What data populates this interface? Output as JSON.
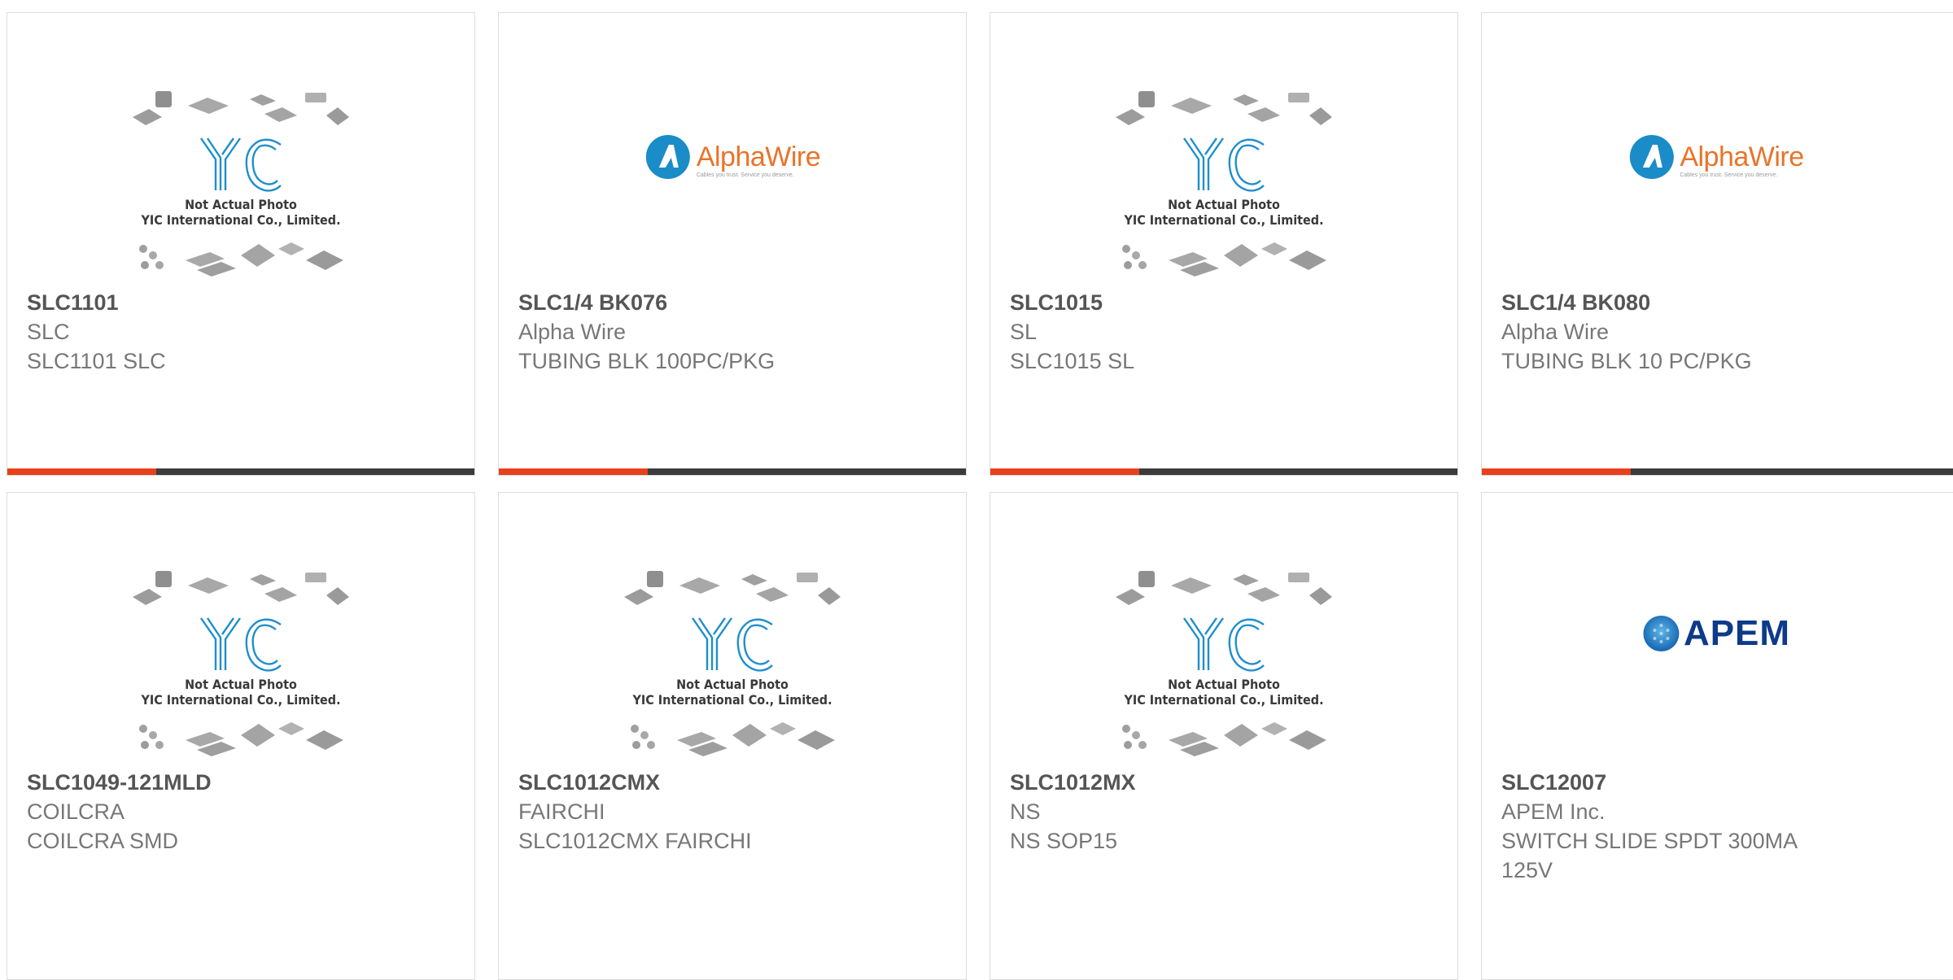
{
  "placeholder": {
    "line1": "Not Actual Photo",
    "line2": "YIC International Co., Limited.",
    "logo": "YIC"
  },
  "brands": {
    "alpha": {
      "name": "AlphaWire",
      "tagline": "Cables you trust. Service you deserve."
    },
    "apem": {
      "name": "APEM"
    }
  },
  "colors": {
    "accent": "#e8401c",
    "bar": "#3b3b3b",
    "text": "#777777",
    "yic_blue": "#1f8fcb"
  },
  "products": [
    {
      "part_number": "SLC1101",
      "manufacturer": "SLC",
      "description": "SLC1101 SLC",
      "image": "yic-placeholder"
    },
    {
      "part_number": "SLC1/4 BK076",
      "manufacturer": "Alpha Wire",
      "description": "TUBING BLK 100PC/PKG",
      "image": "alphawire-logo"
    },
    {
      "part_number": "SLC1015",
      "manufacturer": "SL",
      "description": "SLC1015 SL",
      "image": "yic-placeholder"
    },
    {
      "part_number": "SLC1/4 BK080",
      "manufacturer": "Alpha Wire",
      "description": "TUBING BLK 10 PC/PKG",
      "image": "alphawire-logo"
    },
    {
      "part_number": "SLC1049-121MLD",
      "manufacturer": "COILCRA",
      "description": "COILCRA SMD",
      "image": "yic-placeholder"
    },
    {
      "part_number": "SLC1012CMX",
      "manufacturer": "FAIRCHI",
      "description": "SLC1012CMX FAIRCHI",
      "image": "yic-placeholder"
    },
    {
      "part_number": "SLC1012MX",
      "manufacturer": "NS",
      "description": "NS SOP15",
      "image": "yic-placeholder"
    },
    {
      "part_number": "SLC12007",
      "manufacturer": "APEM Inc.",
      "description": "SWITCH SLIDE SPDT 300MA 125V",
      "image": "apem-logo"
    }
  ]
}
